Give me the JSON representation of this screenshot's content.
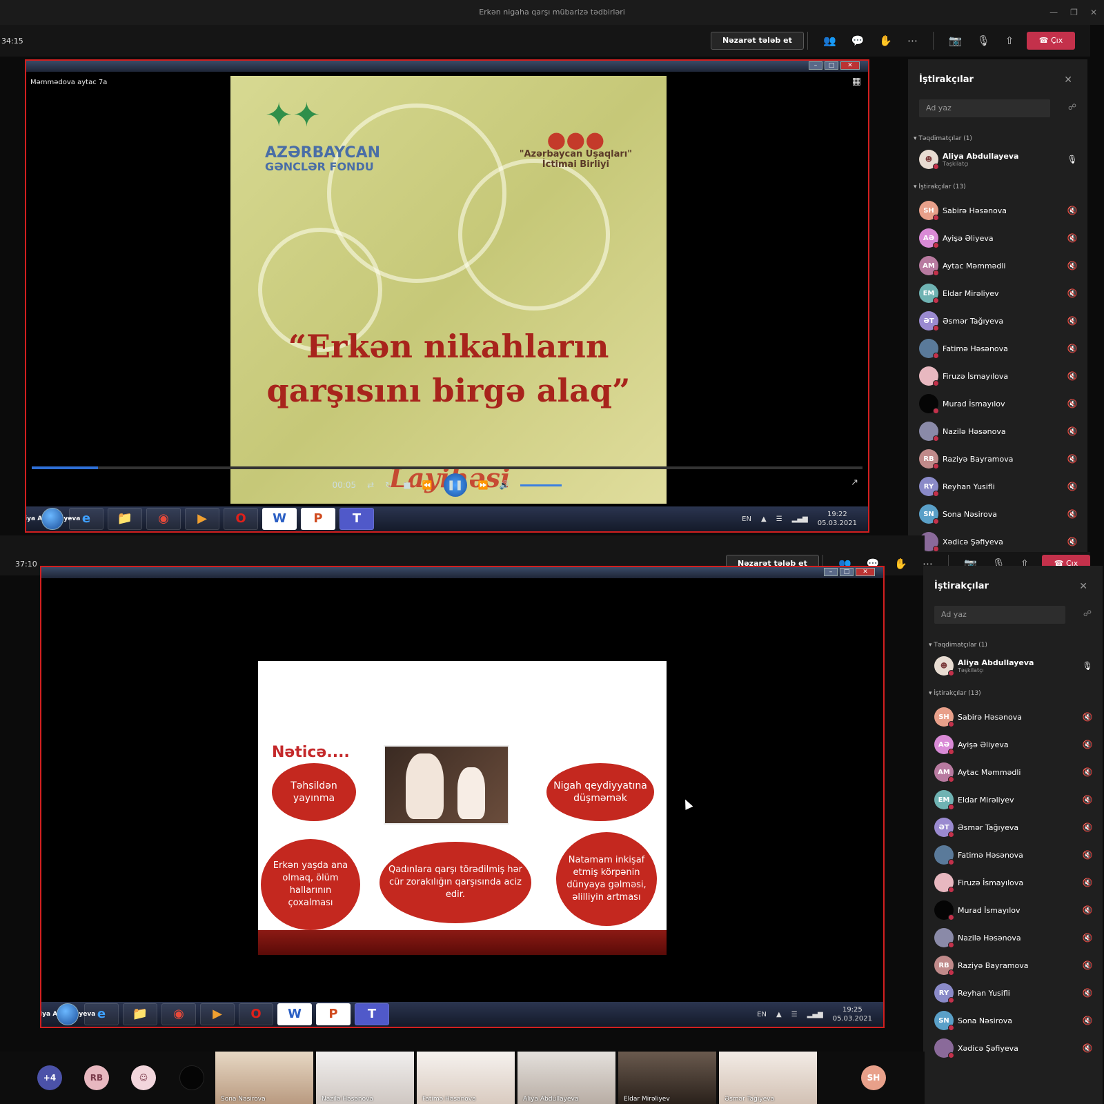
{
  "window": {
    "title": "Erkən nigaha qarşı mübarizə tədbirləri"
  },
  "colors": {
    "leave": "#c4314b",
    "stage_border": "#d21f1f",
    "sidebar_bg": "#1f1f1f"
  },
  "toolbar": {
    "request_control": "Nəzarət tələb et",
    "leave_label": "Çıx"
  },
  "panes": [
    {
      "timer": "34:15",
      "presenter_label": "Məmmədova aytac 7a",
      "slide": {
        "logo_left_1": "AZƏRBAYCAN",
        "logo_left_2": "GƏNCLƏR FONDU",
        "logo_right_1": "\"Azərbaycan Uşaqları\"",
        "logo_right_2": "İctimai Birliyi",
        "quote_1": "“Erkən nikahların",
        "quote_2": "qarşısını birgə alaq”",
        "partial": "Layihəsi",
        "time": "00:05",
        "progress": 0.08
      },
      "taskbar": {
        "user": "Aliya Abdullayeva",
        "lang": "EN",
        "time": "19:22",
        "date": "05.03.2021"
      }
    },
    {
      "timer": "37:10",
      "slide": {
        "title": "Nəticə....",
        "bubbles": [
          "Təhsildən yayınma",
          "Nigah qeydiyyatına düşməmək",
          "Erkən yaşda ana olmaq, ölüm hallarının çoxalması",
          "Qadınlara qarşı törədilmiş hər cür zorakılığın qarşısında aciz edir.",
          "Natamam inkişaf etmiş körpənin dünyaya gəlməsi, əlilliyin artması"
        ]
      },
      "taskbar": {
        "user": "Aliya Abdullayeva",
        "lang": "EN",
        "time": "19:25",
        "date": "05.03.2021"
      }
    }
  ],
  "sidebar": {
    "title": "İştirakçılar",
    "search_placeholder": "Ad yaz",
    "presenters_header": "Təqdimatçılar (1)",
    "presenter": {
      "name": "Aliya Abdullayeva",
      "role": "Təşkilatçı"
    },
    "attendees_header": "İştirakçılar (13)",
    "attendees": [
      {
        "initials": "SH",
        "name": "Sabirə Həsənova",
        "color": "#e8a08a"
      },
      {
        "initials": "AƏ",
        "name": "Ayişə Əliyeva",
        "color": "#d98ad6"
      },
      {
        "initials": "AM",
        "name": "Aytac Məmmədli",
        "color": "#b87aa0"
      },
      {
        "initials": "EM",
        "name": "Eldar Mirəliyev",
        "color": "#6fb3b3"
      },
      {
        "initials": "ƏT",
        "name": "Əsmər Tağıyeva",
        "color": "#9a8ad0"
      },
      {
        "initials": "",
        "name": "Fatimə Həsənova",
        "color": "#5a7a9a"
      },
      {
        "initials": "",
        "name": "Firuzə İsmayılova",
        "color": "#e8b8c0"
      },
      {
        "initials": "",
        "name": "Murad İsmayılov",
        "color": "#050505"
      },
      {
        "initials": "",
        "name": "Nazilə Həsənova",
        "color": "#8a8aa8"
      },
      {
        "initials": "RB",
        "name": "Raziyə Bayramova",
        "color": "#c08a8a"
      },
      {
        "initials": "RY",
        "name": "Reyhan Yusifli",
        "color": "#8a8ac8"
      },
      {
        "initials": "SN",
        "name": "Sona Nəsirova",
        "color": "#5aa0c8"
      },
      {
        "initials": "",
        "name": "Xədicə Şəfiyeva",
        "color": "#8a6a9a"
      }
    ]
  },
  "video_strip": {
    "extra_count": "+4",
    "circles": [
      "RB",
      "SH"
    ],
    "tiles": [
      "Sona Nəsirova",
      "Nazilə Həsənova",
      "Fatimə Həsənova",
      "Aliya Abdullayeva",
      "Eldar Mirəliyev",
      "Əsmər Tağıyeva"
    ]
  }
}
